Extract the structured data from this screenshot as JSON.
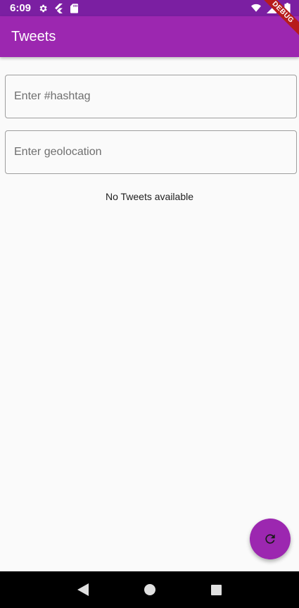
{
  "status_bar": {
    "time": "6:09",
    "icons": [
      "settings-icon",
      "flutter-icon",
      "sd-card-icon",
      "wifi-icon",
      "signal-icon",
      "battery-icon"
    ]
  },
  "app_bar": {
    "title": "Tweets",
    "color": "#9c27b0"
  },
  "debug_banner": {
    "label": "DEBUG"
  },
  "form": {
    "hashtag_placeholder": "Enter #hashtag",
    "hashtag_value": "",
    "geolocation_placeholder": "Enter geolocation",
    "geolocation_value": ""
  },
  "main": {
    "empty_message": "No Tweets available"
  },
  "fab": {
    "icon": "refresh-icon",
    "color": "#9c27b0"
  },
  "nav_bar": {
    "buttons": [
      "back-icon",
      "home-icon",
      "recents-icon"
    ]
  }
}
